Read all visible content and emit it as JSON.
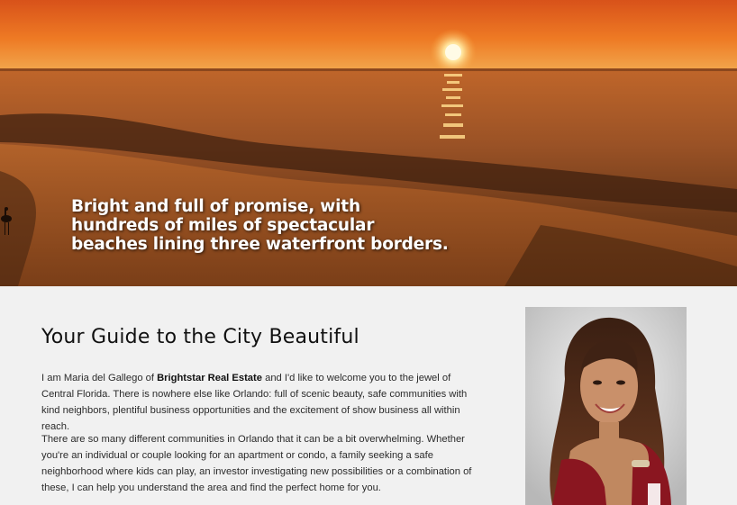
{
  "hero": {
    "headline_line1": "Bright and full of promise, with",
    "headline_line2": "hundreds of miles of spectacular",
    "headline_line3": "beaches lining three waterfront borders."
  },
  "main": {
    "title": "Your Guide to the City Beautiful",
    "paragraph1": {
      "before": "I am Maria del Gallego of ",
      "bold": "Brightstar Real Estate",
      "after": " and I'd like to welcome you to the jewel of Central Florida. There is nowhere else like Orlando: full of scenic beauty, safe communities with kind neighbors, plentiful business opportunities and the excitement of show business all within reach."
    },
    "paragraph2": "There are so many different communities in Orlando that it can be a bit overwhelming. Whether you're an individual or couple looking for an apartment or condo, a family seeking a safe neighborhood where kids can play, an investor investigating new possibilities or a combination of these, I can help you understand the area and find the perfect home for you."
  },
  "colors": {
    "sky_top": "#e2581a",
    "sky_bottom": "#f0a04a",
    "sea": "#8a4a22",
    "background": "#f1f1f1"
  },
  "icons": {
    "hero_image": "sunset-beach-photo",
    "portrait": "agent-portrait-photo"
  }
}
